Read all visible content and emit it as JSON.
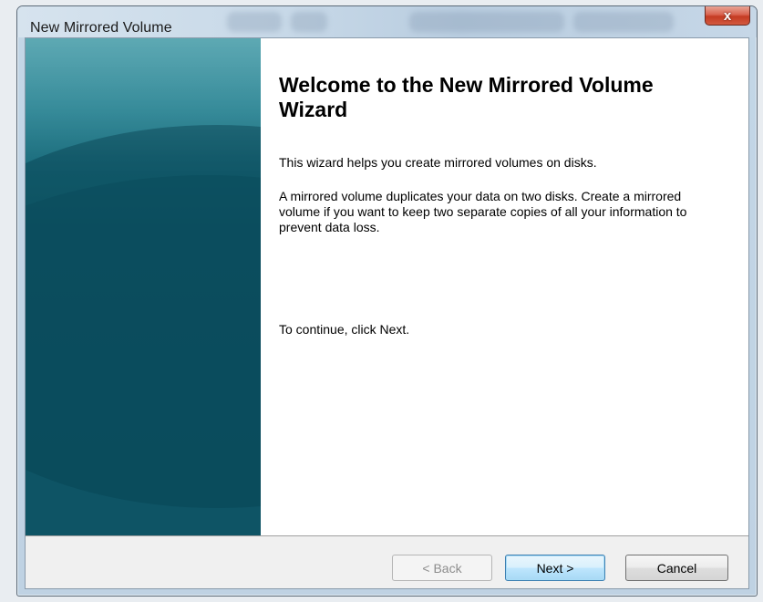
{
  "window": {
    "title": "New Mirrored Volume",
    "close_label": "x"
  },
  "wizard": {
    "heading": "Welcome to the New Mirrored Volume Wizard",
    "intro": "This wizard helps you create mirrored volumes on disks.",
    "description": "A mirrored volume duplicates your data on two disks. Create a mirrored volume if you want to keep two separate copies of all your information to prevent  data loss.",
    "continue_hint": "To continue, click Next."
  },
  "buttons": {
    "back": "< Back",
    "next": "Next >",
    "cancel": "Cancel"
  },
  "colors": {
    "sidebar": "#15606f",
    "close_button": "#c43b22",
    "default_button_border": "#3c7fb1"
  }
}
